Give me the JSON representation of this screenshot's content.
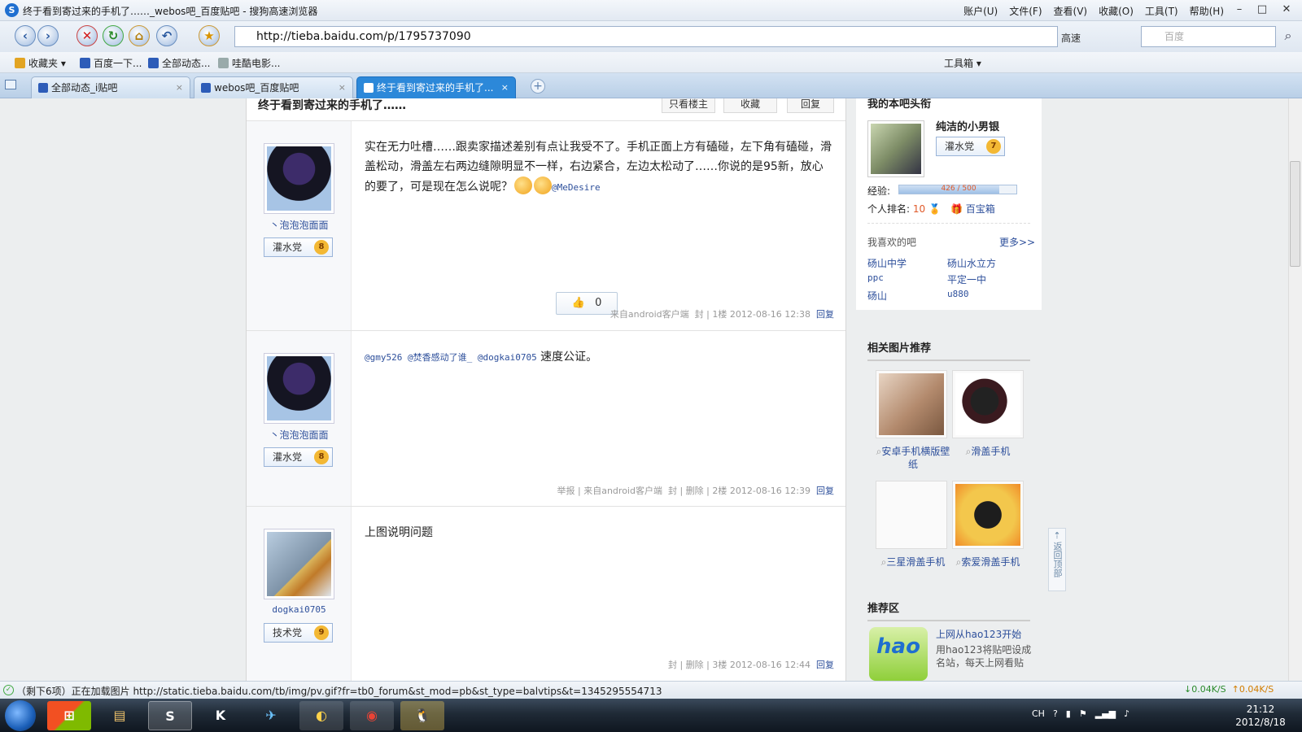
{
  "window": {
    "title": "终于看到寄过来的手机了……_webos吧_百度贴吧 - 搜狗高速浏览器",
    "logo": "S",
    "menus": [
      "账户(U)",
      "文件(F)",
      "查看(V)",
      "收藏(O)",
      "工具(T)",
      "帮助(H)"
    ],
    "minimize": "–",
    "maximize": "□",
    "close": "✕"
  },
  "toolbar": {
    "back": "‹",
    "forward": "›",
    "stop": "✕",
    "refresh": "↻",
    "home": "⌂",
    "undo": "↶",
    "favorite": "★",
    "address": "http://tieba.baidu.com/p/1795737090",
    "speed_mode": "高速",
    "search_placeholder": "百度",
    "search_icon": "⌕"
  },
  "bookmarks": {
    "favorites": "收藏夹",
    "items": [
      "百度一下...",
      "全部动态...",
      "哇酷电影..."
    ],
    "toolbox": "工具箱"
  },
  "tabs": [
    {
      "label": "全部动态_i贴吧",
      "close": "×"
    },
    {
      "label": "webos吧_百度贴吧",
      "close": "×"
    },
    {
      "label": "终于看到寄过来的手机了...",
      "close": "×"
    },
    {
      "label": "+"
    }
  ],
  "thread": {
    "title": "终于看到寄过来的手机了……",
    "only_op": "只看楼主",
    "collect": "收藏",
    "reply": "回复"
  },
  "posts": [
    {
      "user": "丶泡泡泡面面",
      "rank": "灌水党",
      "level": "8",
      "text": "实在无力吐槽……跟卖家描述差别有点让我受不了。手机正面上方有磕碰，左下角有磕碰，滑盖松动，滑盖左右两边缝隙明显不一样，右边紧合，左边太松动了……你说的是95新，放心的要了，可是现在怎么说呢？",
      "mention": "@MeDesire",
      "likes": "0",
      "meta": {
        "from": "来自android客户端",
        "ban": "封",
        "floor": "1楼",
        "time": "2012-08-16 12:38",
        "reply": "回复"
      }
    },
    {
      "user": "丶泡泡泡面面",
      "rank": "灌水党",
      "level": "8",
      "mentions": "@gmy526 @焚香感动了谁_ @dogkai0705",
      "text": "速度公证。",
      "meta": {
        "report": "举报",
        "from": "来自android客户端",
        "ban": "封",
        "delete": "删除",
        "floor": "2楼",
        "time": "2012-08-16 12:39",
        "reply": "回复"
      }
    },
    {
      "user": "dogkai0705",
      "rank": "技术党",
      "level": "9",
      "text": "上图说明问题",
      "meta": {
        "ban": "封",
        "delete": "删除",
        "floor": "3楼",
        "time": "2012-08-16 12:44",
        "reply": "回复"
      }
    }
  ],
  "sidebar": {
    "title": "我的本吧头衔",
    "user": "纯洁的小男银",
    "rank": "灌水党",
    "level": "7",
    "exp_label": "经验:",
    "exp_value": "426 / 500",
    "exp_fraction": 0.852,
    "ranking_label": "个人排名:",
    "ranking": "10",
    "treasure": "百宝箱",
    "liked_title": "我喜欢的吧",
    "more": "更多>>",
    "liked": [
      "砀山中学",
      "砀山水立方",
      "ppc",
      "平定一中",
      "砀山",
      "u880"
    ],
    "images_title": "相关图片推荐",
    "images": [
      "安卓手机横版壁纸",
      "滑盖手机",
      "三星滑盖手机",
      "索爱滑盖手机"
    ],
    "rec_title": "推荐区",
    "rec_logo": "hao",
    "rec_link": "上网从hao123开始",
    "rec_text": "用hao123将贴吧设成名站，每天上网看贴"
  },
  "backtop": "返回顶部",
  "status": {
    "text": "（剩下6项）正在加载图片 http://static.tieba.baidu.com/tb/img/pv.gif?fr=tb0_forum&st_mod=pb&st_type=balvtips&t=1345295554713",
    "down": "↓0.04K/S",
    "up": "↑0.04K/S"
  },
  "taskbar": {
    "apps": [
      "⊞",
      "▤",
      "S",
      "K",
      "✈",
      "◐",
      "◉",
      "🐧"
    ],
    "lang": "CH",
    "time": "21:12",
    "date": "2012/8/18"
  }
}
